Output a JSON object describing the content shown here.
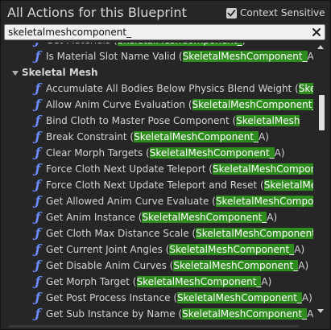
{
  "header": {
    "title": "All Actions for this Blueprint",
    "context_sensitive_label": "Context Sensitive",
    "context_sensitive_checked": true,
    "more_icon": "triangle-down-icon"
  },
  "search": {
    "value": "skeletalmeshcomponent_",
    "clear_icon": "close-icon"
  },
  "colors": {
    "highlight": "#2e8b1e",
    "function_icon": "#6b8cff",
    "panel_bg": "#262626",
    "search_bg": "#f0f0f0"
  },
  "tree": {
    "top_rows": [
      {
        "name": "Get Materials (",
        "match": "SkeletalMeshComponent_",
        "suffix": ")"
      },
      {
        "name": "Is Material Slot Name Valid (",
        "match": "SkeletalMeshComponent_",
        "suffix": "A)"
      }
    ],
    "category": "Skeletal Mesh",
    "rows": [
      {
        "name": "Accumulate All Bodies Below Physics Blend Weight (",
        "match": "Skel",
        "suffix": ""
      },
      {
        "name": "Allow Anim Curve Evaluation (",
        "match": "SkeletalMeshComponent_",
        "suffix": "A"
      },
      {
        "name": "Bind Cloth to Master Pose Component (",
        "match": "SkeletalMesh",
        "suffix": ""
      },
      {
        "name": "Break Constraint (",
        "match": "SkeletalMeshComponent_",
        "suffix": "A)"
      },
      {
        "name": "Clear Morph Targets (",
        "match": "SkeletalMeshComponent_",
        "suffix": "A)"
      },
      {
        "name": "Force Cloth Next Update Teleport (",
        "match": "SkeletalMeshCompon",
        "suffix": ""
      },
      {
        "name": "Force Cloth Next Update Teleport and Reset (",
        "match": "SkeletalMes",
        "suffix": ""
      },
      {
        "name": "Get Allowed Anim Curve Evaluate (",
        "match": "SkeletalMeshComponent",
        "suffix": ""
      },
      {
        "name": "Get Anim Instance (",
        "match": "SkeletalMeshComponent_",
        "suffix": "A)"
      },
      {
        "name": "Get Cloth Max Distance Scale (",
        "match": "SkeletalMeshComponent_",
        "suffix": "A"
      },
      {
        "name": "Get Current Joint Angles (",
        "match": "SkeletalMeshComponent_",
        "suffix": "A)"
      },
      {
        "name": "Get Disable Anim Curves (",
        "match": "SkeletalMeshComponent_",
        "suffix": "A)"
      },
      {
        "name": "Get Morph Target (",
        "match": "SkeletalMeshComponent_",
        "suffix": "A)"
      },
      {
        "name": "Get Post Process Instance (",
        "match": "SkeletalMeshComponent_",
        "suffix": "A)"
      },
      {
        "name": "Get Sub Instance by Name (",
        "match": "SkeletalMeshComponent_",
        "suffix": "A)"
      }
    ]
  }
}
